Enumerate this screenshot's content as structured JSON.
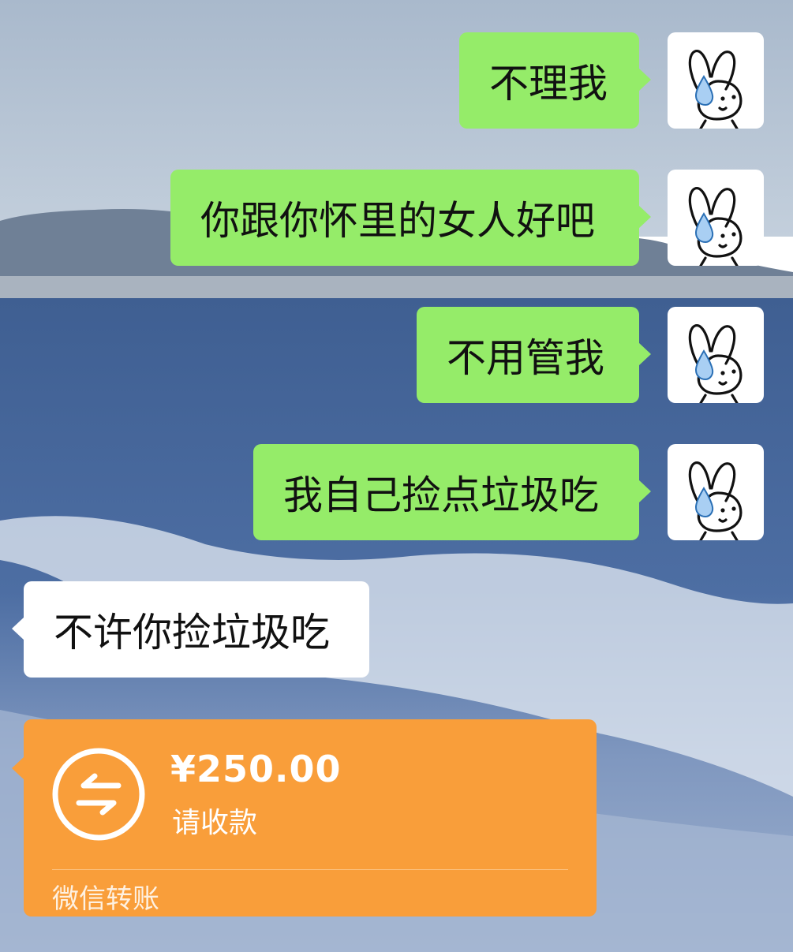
{
  "messages": [
    {
      "side": "right",
      "text": "不理我"
    },
    {
      "side": "right",
      "text": "你跟你怀里的女人好吧"
    },
    {
      "side": "right",
      "text": "不用管我"
    },
    {
      "side": "right",
      "text": "我自己捡点垃圾吃"
    },
    {
      "side": "left",
      "text": "不许你捡垃圾吃"
    }
  ],
  "avatar_icon": "bunny-sweat-drop-icon",
  "transfer": {
    "amount": "¥250.00",
    "note": "请收款",
    "footer": "微信转账",
    "icon": "transfer-arrows-icon",
    "color": "#f99e3a"
  },
  "colors": {
    "sent_bubble": "#95ec69",
    "received_bubble": "#ffffff"
  }
}
